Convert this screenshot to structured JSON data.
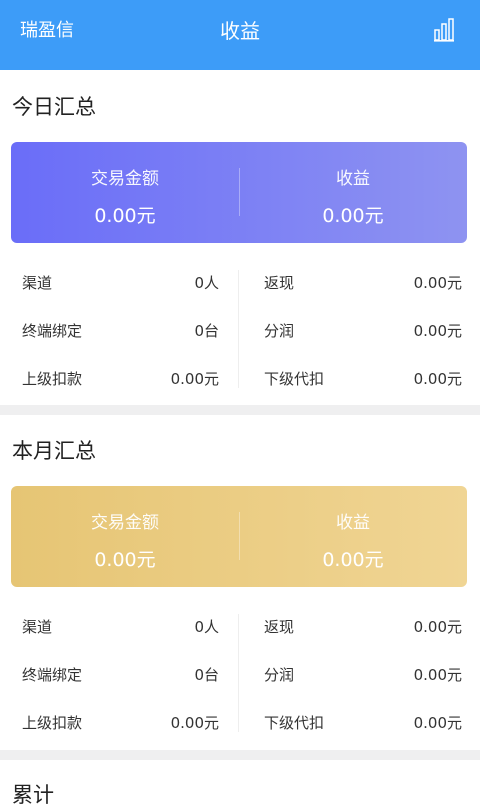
{
  "header": {
    "left": "瑞盈信",
    "title": "收益",
    "icon": "bar-chart-icon"
  },
  "today": {
    "title": "今日汇总",
    "card": {
      "left_label": "交易金额",
      "left_value": "0.00元",
      "right_label": "收益",
      "right_value": "0.00元"
    },
    "stats": {
      "left": [
        {
          "label": "渠道",
          "value": "0人"
        },
        {
          "label": "终端绑定",
          "value": "0台"
        },
        {
          "label": "上级扣款",
          "value": "0.00元"
        }
      ],
      "right": [
        {
          "label": "返现",
          "value": "0.00元"
        },
        {
          "label": "分润",
          "value": "0.00元"
        },
        {
          "label": "下级代扣",
          "value": "0.00元"
        }
      ]
    }
  },
  "month": {
    "title": "本月汇总",
    "card": {
      "left_label": "交易金额",
      "left_value": "0.00元",
      "right_label": "收益",
      "right_value": "0.00元"
    },
    "stats": {
      "left": [
        {
          "label": "渠道",
          "value": "0人"
        },
        {
          "label": "终端绑定",
          "value": "0台"
        },
        {
          "label": "上级扣款",
          "value": "0.00元"
        }
      ],
      "right": [
        {
          "label": "返现",
          "value": "0.00元"
        },
        {
          "label": "分润",
          "value": "0.00元"
        },
        {
          "label": "下级代扣",
          "value": "0.00元"
        }
      ]
    }
  },
  "total": {
    "title": "累计"
  },
  "colors": {
    "header": "#3d9cf8",
    "today_card": "#6a6df8",
    "month_card": "#e6c574",
    "separator": "#efeff0"
  }
}
